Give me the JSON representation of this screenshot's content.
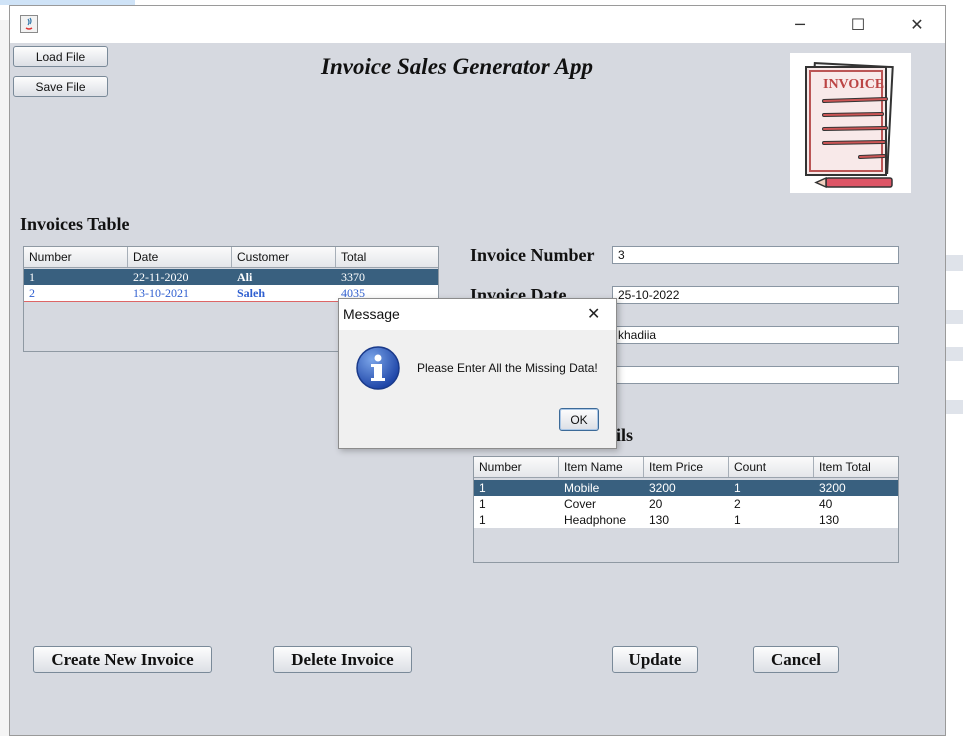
{
  "window": {
    "title_controls": {
      "minimize": "─",
      "maximize": "☐",
      "close": "✕"
    }
  },
  "toolbar": {
    "load_label": "Load File",
    "save_label": "Save File"
  },
  "app_title": "Invoice Sales Generator App",
  "logo_text": "INVOICE",
  "invoices_table": {
    "title": "Invoices Table",
    "columns": [
      "Number",
      "Date",
      "Customer",
      "Total"
    ],
    "rows": [
      {
        "number": "1",
        "date": "22-11-2020",
        "customer": "Ali",
        "total": "3370",
        "selected": true
      },
      {
        "number": "2",
        "date": "13-10-2021",
        "customer": "Saleh",
        "total": "4035",
        "selected": false
      }
    ]
  },
  "invoice_form": {
    "number_label": "Invoice Number",
    "number_value": "3",
    "date_label": "Invoice Date",
    "date_value": "25-10-2022",
    "customer_value": "khadiia",
    "total_value": ""
  },
  "items_table": {
    "title_fragment": "ils",
    "columns": [
      "Number",
      "Item Name",
      "Item Price",
      "Count",
      "Item Total"
    ],
    "rows": [
      {
        "number": "1",
        "name": "Mobile",
        "price": "3200",
        "count": "1",
        "total": "3200",
        "selected": true
      },
      {
        "number": "1",
        "name": "Cover",
        "price": "20",
        "count": "2",
        "total": "40",
        "selected": false
      },
      {
        "number": "1",
        "name": "Headphone",
        "price": "130",
        "count": "1",
        "total": "130",
        "selected": false
      }
    ]
  },
  "buttons": {
    "create": "Create New Invoice",
    "delete": "Delete Invoice",
    "update": "Update",
    "cancel": "Cancel"
  },
  "dialog": {
    "title": "Message",
    "message": "Please Enter All the Missing Data!",
    "ok": "OK",
    "close": "✕"
  },
  "colors": {
    "window_bg": "#d6d9e0",
    "selection": "#39607f",
    "link_blue": "#2f5fd0"
  }
}
